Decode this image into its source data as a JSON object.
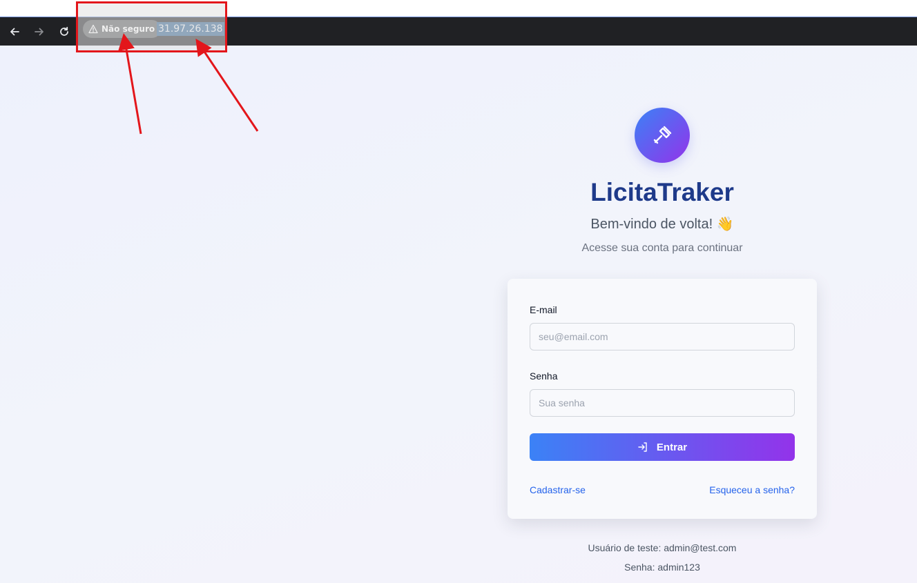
{
  "browser": {
    "security_label": "Não seguro",
    "url": "31.97.26.138",
    "accent_color": "#5f86d6"
  },
  "annotation": {
    "color": "#e3161b"
  },
  "login": {
    "brand": "LicitaTraker",
    "welcome": "Bem-vindo de volta! 👋",
    "subtitle": "Acesse sua conta para continuar",
    "email_label": "E-mail",
    "email_placeholder": "seu@email.com",
    "email_value": "",
    "password_label": "Senha",
    "password_placeholder": "Sua senha",
    "password_value": "",
    "submit_label": "Entrar",
    "register_link": "Cadastrar-se",
    "forgot_link": "Esqueceu a senha?",
    "test_user": "Usuário de teste: admin@test.com",
    "test_password": "Senha: admin123",
    "logo_icon": "gavel-icon",
    "gradient_start": "#3b82f6",
    "gradient_end": "#9333ea",
    "title_color": "#1e3a8a",
    "link_color": "#2563eb"
  }
}
